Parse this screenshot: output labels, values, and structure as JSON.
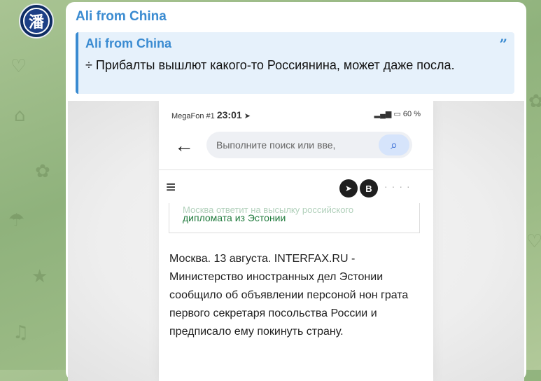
{
  "message": {
    "sender": "Ali from China",
    "avatar_glyph": "潘",
    "reply": {
      "name": "Ali from China",
      "text": "÷ Прибалты вышлют какого-то Россиянина, может даже посла."
    }
  },
  "screenshot": {
    "status": {
      "carrier": "MegaFon #1",
      "time": "23:01",
      "battery": "60 %"
    },
    "search_placeholder": "Выполните поиск или вве,",
    "related_link": "дипломата из Эстонии",
    "related_cut": "Москва ответит на высылку российского",
    "article_text": "Москва. 13 августа. INTERFAX.RU - Министерство иностранных дел Эстонии сообщило об объявлении персоной нон грата первого секретаря посольства России и предписало ему покинуть страну."
  },
  "icons": {
    "back": "arrow-left-icon",
    "search": "search-icon",
    "menu": "hamburger-menu-icon",
    "telegram": "telegram-icon",
    "vk": "vk-icon",
    "quote": "quote-icon"
  },
  "colors": {
    "accent": "#3a8bd1",
    "link_green": "#1f7a3c"
  }
}
